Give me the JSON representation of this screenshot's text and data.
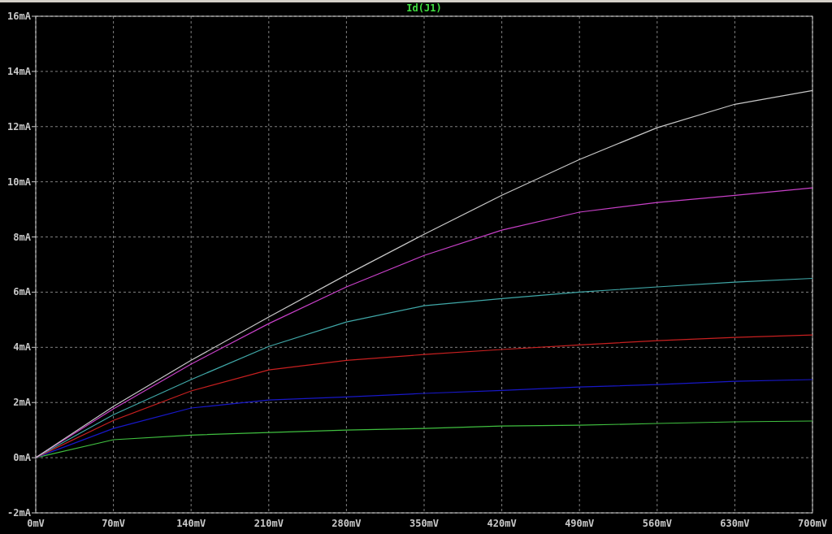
{
  "plot": {
    "chart_data": {
      "type": "line",
      "title": "Id(J1)",
      "x": [
        0,
        70,
        140,
        210,
        280,
        350,
        420,
        490,
        560,
        630,
        700
      ],
      "grid": true,
      "xlim": [
        0,
        700
      ],
      "ylim": [
        -2,
        16
      ],
      "xticks": [
        {
          "value": 0,
          "label": "0mV"
        },
        {
          "value": 70,
          "label": "70mV"
        },
        {
          "value": 140,
          "label": "140mV"
        },
        {
          "value": 210,
          "label": "210mV"
        },
        {
          "value": 280,
          "label": "280mV"
        },
        {
          "value": 350,
          "label": "350mV"
        },
        {
          "value": 420,
          "label": "420mV"
        },
        {
          "value": 490,
          "label": "490mV"
        },
        {
          "value": 560,
          "label": "560mV"
        },
        {
          "value": 630,
          "label": "630mV"
        },
        {
          "value": 700,
          "label": "700mV"
        }
      ],
      "yticks": [
        {
          "value": 16,
          "label": "16mA"
        },
        {
          "value": 14,
          "label": "14mA"
        },
        {
          "value": 12,
          "label": "12mA"
        },
        {
          "value": 10,
          "label": "10mA"
        },
        {
          "value": 8,
          "label": "8mA"
        },
        {
          "value": 6,
          "label": "6mA"
        },
        {
          "value": 4,
          "label": "4mA"
        },
        {
          "value": 2,
          "label": "2mA"
        },
        {
          "value": 0,
          "label": "0mA"
        },
        {
          "value": -2,
          "label": "-2mA"
        }
      ],
      "series": [
        {
          "color": "#40c040",
          "values": [
            0,
            0.65,
            0.82,
            0.91,
            1.0,
            1.06,
            1.15,
            1.18,
            1.24,
            1.3,
            1.33
          ]
        },
        {
          "color": "#1818c8",
          "values": [
            0,
            1.06,
            1.8,
            2.09,
            2.2,
            2.33,
            2.44,
            2.56,
            2.65,
            2.77,
            2.83
          ]
        },
        {
          "color": "#c82020",
          "values": [
            0,
            1.35,
            2.42,
            3.18,
            3.53,
            3.74,
            3.92,
            4.09,
            4.24,
            4.36,
            4.45
          ]
        },
        {
          "color": "#40a8a8",
          "values": [
            0,
            1.56,
            2.83,
            4.03,
            4.92,
            5.51,
            5.77,
            6.0,
            6.19,
            6.36,
            6.5
          ]
        },
        {
          "color": "#c840c8",
          "values": [
            0,
            1.77,
            3.39,
            4.86,
            6.19,
            7.33,
            8.25,
            8.9,
            9.25,
            9.51,
            9.78
          ]
        },
        {
          "color": "#c8c8c8",
          "values": [
            0,
            1.86,
            3.53,
            5.1,
            6.63,
            8.1,
            9.51,
            10.81,
            11.96,
            12.81,
            13.31
          ]
        }
      ]
    }
  }
}
